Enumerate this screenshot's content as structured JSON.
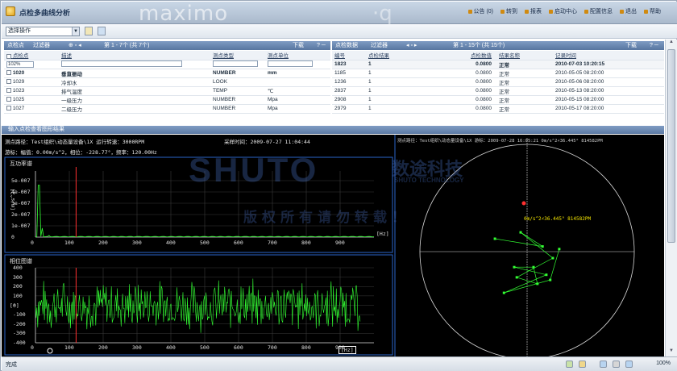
{
  "app": {
    "title": "点检多曲线分析",
    "logo_text": "maximo",
    "logo_tail": "·q"
  },
  "topnav": [
    "公告 (0)",
    "转到",
    "报表",
    "启动中心",
    "配置信息",
    "退出",
    "帮助"
  ],
  "toolbar": {
    "select_value": "选择操作"
  },
  "left_panel": {
    "title": "点检点",
    "filter_label": "过滤器",
    "paging": "第 1 - 7个 (共 7个)",
    "download": "下载",
    "columns": [
      "点检点",
      "描述",
      "测点类型",
      "测点单位"
    ],
    "filter_value": "102%",
    "rows": [
      {
        "id": "1020",
        "desc": "垂直振动",
        "type": "NUMBER",
        "unit": "mm",
        "bold": true
      },
      {
        "id": "1029",
        "desc": "冷却水",
        "type": "LOOK",
        "unit": "",
        "bold": false
      },
      {
        "id": "1023",
        "desc": "排气温度",
        "type": "TEMP",
        "unit": "℃",
        "bold": false
      },
      {
        "id": "1025",
        "desc": "一级压力",
        "type": "NUMBER",
        "unit": "Mpa",
        "bold": false
      },
      {
        "id": "1027",
        "desc": "二级压力",
        "type": "NUMBER",
        "unit": "Mpa",
        "bold": false
      }
    ]
  },
  "right_panel": {
    "title": "点检数据",
    "filter_label": "过滤器",
    "paging": "第 1 - 15个 (共 15个)",
    "download": "下载",
    "columns": [
      "编号",
      "点检结果",
      "点检数值",
      "结果名称",
      "记录时间"
    ],
    "rows": [
      {
        "no": "1823",
        "result": "1",
        "value": "0.0800",
        "name": "正常",
        "time": "2010-07-03 10:20:15",
        "bold": true
      },
      {
        "no": "1185",
        "result": "1",
        "value": "0.0800",
        "name": "正常",
        "time": "2010-05-05 08:20:00",
        "bold": false
      },
      {
        "no": "1236",
        "result": "1",
        "value": "0.0800",
        "name": "正常",
        "time": "2010-05-06 08:20:00",
        "bold": false
      },
      {
        "no": "2837",
        "result": "1",
        "value": "0.0800",
        "name": "正常",
        "time": "2010-05-13 08:20:00",
        "bold": false
      },
      {
        "no": "2908",
        "result": "1",
        "value": "0.0800",
        "name": "正常",
        "time": "2010-05-15 08:20:00",
        "bold": false
      },
      {
        "no": "2979",
        "result": "1",
        "value": "0.0800",
        "name": "正常",
        "time": "2010-05-17 08:20:00",
        "bold": false
      }
    ]
  },
  "section_title": "输入点检查看图形结果",
  "chart_info": {
    "line1": "测点路径：Test组织\\动态量设备\\1X  运行转速：3000RPM",
    "time": "采样时间：2009-07-27 11:04:44",
    "line2": "游标：幅值：0.00m/s^2，相位：-228.77°，频率：120.00Hz",
    "polar_header": "测点路径：Test组织\\动态量设备\\1X  游标：2009-07-28 16:05:21 0m/s^2∠36.445° 814582PM",
    "polar_annotation": "0m/s^2∠36.445° 814582PM"
  },
  "watermark": {
    "brand": "SHUTO",
    "company_cn": "数途科技",
    "company_en": "SHUTO TECHNOLOGY",
    "slogan": "版权所有请勿转载！"
  },
  "chart_data": [
    {
      "type": "line",
      "title": "互功率谱",
      "xlabel": "[Hz]",
      "ylabel": "[m/s^2]",
      "xlim": [
        0,
        1000
      ],
      "ylim": [
        0,
        5.5e-07
      ],
      "x_ticks": [
        "0",
        "100",
        "200",
        "300",
        "400",
        "500",
        "600",
        "700",
        "800",
        "900"
      ],
      "y_ticks": [
        "0",
        "1e-007",
        "2e-007",
        "3e-007",
        "4e-007",
        "5e-007"
      ],
      "cursor_x": 120,
      "series": [
        {
          "values_description_free": true,
          "peaks": [
            [
              10,
              4.6e-07
            ],
            [
              20,
              8e-08
            ],
            [
              40,
              1.5e-08
            ]
          ]
        }
      ],
      "colors": {
        "line": "#33ff33",
        "cursor": "#ff3030"
      }
    },
    {
      "type": "line",
      "title": "相位图谱",
      "xlabel": "[Hz]",
      "ylabel": "[°]",
      "xlim": [
        0,
        1000
      ],
      "ylim": [
        -400,
        400
      ],
      "x_ticks": [
        "0",
        "100",
        "200",
        "300",
        "400",
        "500",
        "600",
        "700",
        "800",
        "900"
      ],
      "y_ticks": [
        "-400",
        "-300",
        "-200",
        "-100",
        "0",
        "100",
        "200",
        "300",
        "400"
      ],
      "cursor_x": 120,
      "amplitude_range": [
        -300,
        300
      ],
      "colors": {
        "line": "#33ff33",
        "cursor": "#ff3030"
      }
    },
    {
      "type": "scatter",
      "title": "",
      "polar": true,
      "points": [
        [
          -0.25,
          0.1
        ],
        [
          0.12,
          0.04
        ],
        [
          -0.05,
          0.15
        ],
        [
          0.2,
          -0.05
        ],
        [
          -0.08,
          -0.2
        ],
        [
          0.08,
          -0.25
        ],
        [
          0.05,
          -0.12
        ],
        [
          -0.1,
          -0.12
        ],
        [
          0.15,
          -0.18
        ],
        [
          -0.18,
          -0.32
        ],
        [
          0.18,
          -0.22
        ],
        [
          0.25,
          0.02
        ]
      ],
      "colors": {
        "points": "#33ff33",
        "marker": "#ff3030"
      }
    }
  ],
  "statusbar": {
    "text": "完成",
    "zoom": "100%"
  }
}
